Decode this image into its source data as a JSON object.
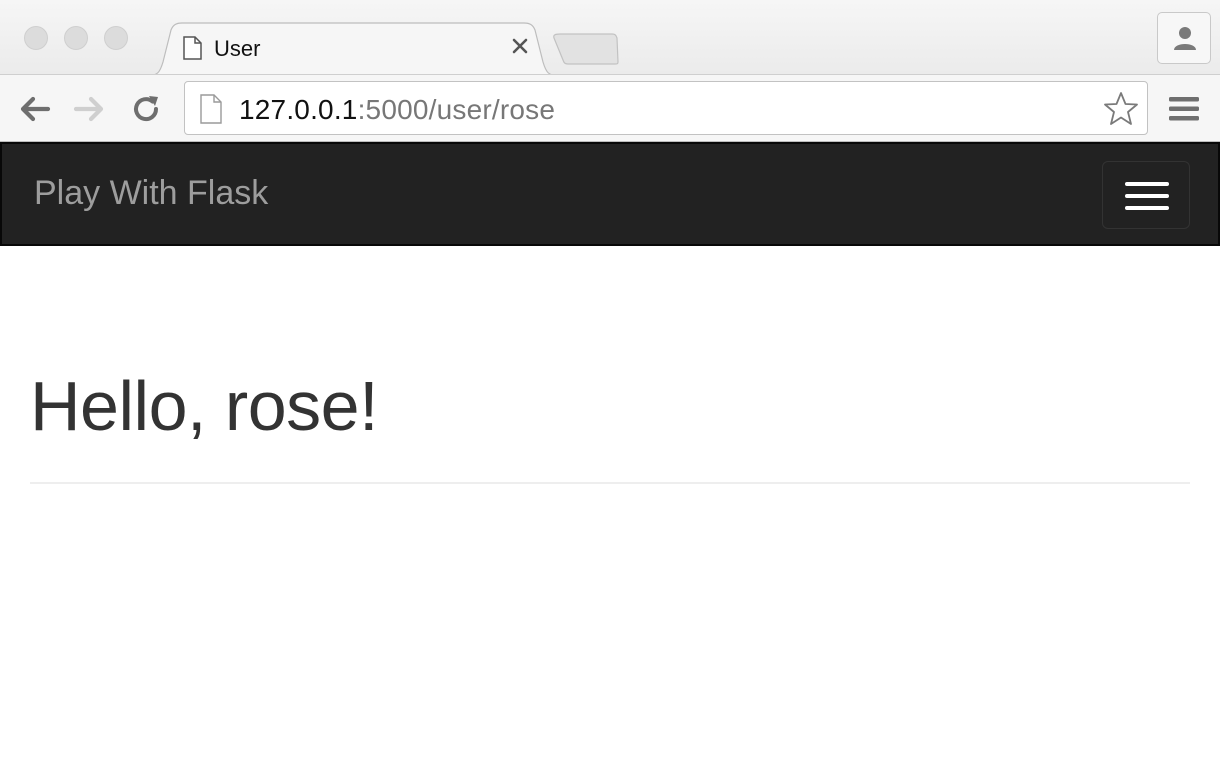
{
  "browser": {
    "tab": {
      "title": "User"
    },
    "address_bar": {
      "host": "127.0.0.1",
      "rest": ":5000/user/rose"
    }
  },
  "icons": {
    "tab": [
      "page-icon",
      "close-icon"
    ],
    "toolbar": [
      "back-arrow-icon",
      "forward-arrow-icon",
      "reload-icon",
      "page-icon",
      "star-icon",
      "menu-icon",
      "profile-icon"
    ],
    "navbar": [
      "hamburger-icon"
    ]
  },
  "navbar": {
    "brand": "Play With Flask"
  },
  "main": {
    "heading": "Hello, rose!"
  },
  "colors": {
    "navbar_bg": "#222222",
    "brand_text": "#9d9d9d",
    "heading_text": "#333333"
  }
}
